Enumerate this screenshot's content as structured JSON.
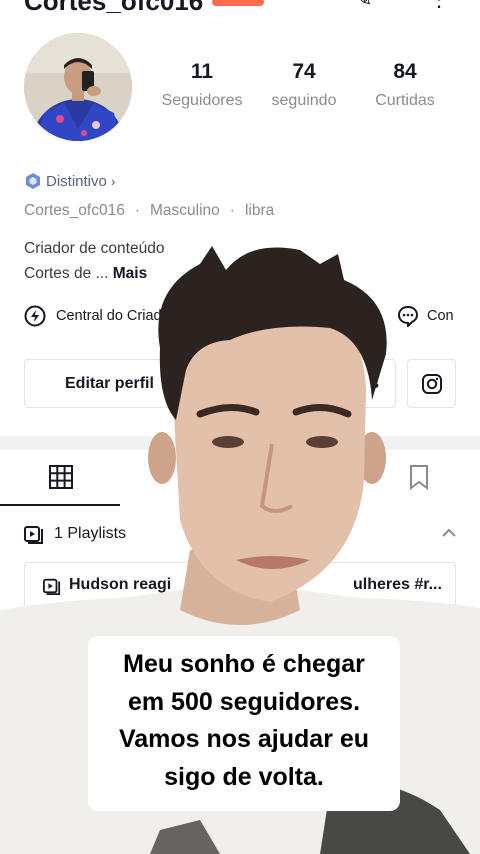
{
  "header": {
    "username": "Cortes_ofc016"
  },
  "stats": [
    {
      "value": "11",
      "label": "Seguidores"
    },
    {
      "value": "74",
      "label": "seguindo"
    },
    {
      "value": "84",
      "label": "Curtidas"
    }
  ],
  "profile": {
    "badge_label": "Distintivo",
    "handle": "Cortes_ofc016",
    "gender": "Masculino",
    "sign": "libra",
    "bio_line1": "Criador de conteúdo",
    "bio_line2": "Cortes de ...",
    "bio_more": "Mais"
  },
  "actions": {
    "creator_center": "Central do Criador",
    "con_label": "Con",
    "edit_profile": "Editar perfil",
    "share_profile_fragment": "s"
  },
  "tabs": [
    "videos-grid",
    "liked",
    "favorites"
  ],
  "playlists": {
    "header": "1 Playlists",
    "chip_start": "Hudson reagi",
    "chip_end": "ulheres #r..."
  },
  "overlay": {
    "caption_line1": "Meu sonho é chegar",
    "caption_line2": "em 500 seguidores.",
    "caption_line3": "Vamos nos ajudar eu",
    "caption_line4": "sigo de volta."
  },
  "colors": {
    "text_primary": "#161823",
    "text_secondary": "#8a8b91",
    "badge_blue": "#58607e",
    "border": "#e3e3e4",
    "accent": "#fe6b4f"
  }
}
